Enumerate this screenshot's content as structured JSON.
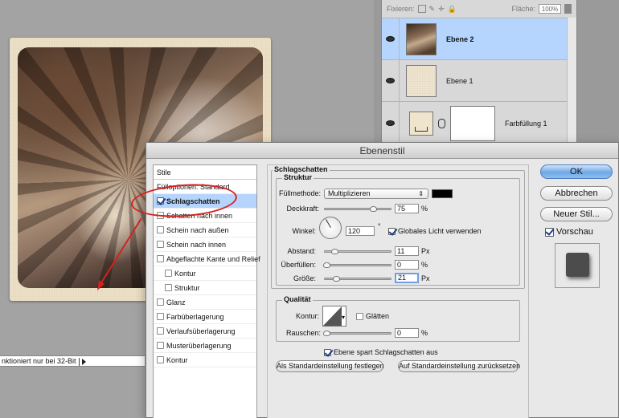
{
  "status_bar": {
    "text": "nktioniert nur bei 32-Bit"
  },
  "layers_panel": {
    "lock_label": "Fixieren:",
    "fill_label": "Fläche:",
    "fill_value": "100%",
    "layers": [
      {
        "name": "Ebene 2",
        "selected": true
      },
      {
        "name": "Ebene 1",
        "selected": false
      },
      {
        "name": "Farbfüllung 1",
        "selected": false
      }
    ]
  },
  "dialog": {
    "title": "Ebenenstil",
    "styles_list": {
      "header": "Stile",
      "blend_options": "Fülloptionen: Standard",
      "items": [
        {
          "label": "Schlagschatten",
          "checked": true,
          "active": true
        },
        {
          "label": "Schatten nach innen",
          "checked": false
        },
        {
          "label": "Schein nach außen",
          "checked": false
        },
        {
          "label": "Schein nach innen",
          "checked": false
        },
        {
          "label": "Abgeflachte Kante und Relief",
          "checked": false
        },
        {
          "label": "Kontur",
          "checked": false,
          "indent": true
        },
        {
          "label": "Struktur",
          "checked": false,
          "indent": true
        },
        {
          "label": "Glanz",
          "checked": false
        },
        {
          "label": "Farbüberlagerung",
          "checked": false
        },
        {
          "label": "Verlaufsüberlagerung",
          "checked": false
        },
        {
          "label": "Musterüberlagerung",
          "checked": false
        },
        {
          "label": "Kontur",
          "checked": false
        }
      ]
    },
    "drop_shadow": {
      "section": "Schlagschatten",
      "structure": "Struktur",
      "blend_mode_label": "Füllmethode:",
      "blend_mode_value": "Multiplizieren",
      "color": "#000000",
      "opacity_label": "Deckkraft:",
      "opacity_value": "75",
      "opacity_unit": "%",
      "angle_label": "Winkel:",
      "angle_value": "120",
      "angle_unit": "°",
      "global_light_label": "Globales Licht verwenden",
      "global_light_checked": true,
      "distance_label": "Abstand:",
      "distance_value": "11",
      "distance_unit": "Px",
      "spread_label": "Überfüllen:",
      "spread_value": "0",
      "spread_unit": "%",
      "size_label": "Größe:",
      "size_value": "21",
      "size_unit": "Px",
      "quality": "Qualität",
      "contour_label": "Kontur:",
      "antialias_label": "Glätten",
      "antialias_checked": false,
      "noise_label": "Rauschen:",
      "noise_value": "0",
      "noise_unit": "%",
      "knockout_label": "Ebene spart Schlagschatten aus",
      "knockout_checked": true,
      "make_default": "Als Standardeinstellung festlegen",
      "reset_default": "Auf Standardeinstellung zurücksetzen"
    },
    "buttons": {
      "ok": "OK",
      "cancel": "Abbrechen",
      "new_style": "Neuer Stil...",
      "preview_label": "Vorschau",
      "preview_checked": true
    }
  }
}
